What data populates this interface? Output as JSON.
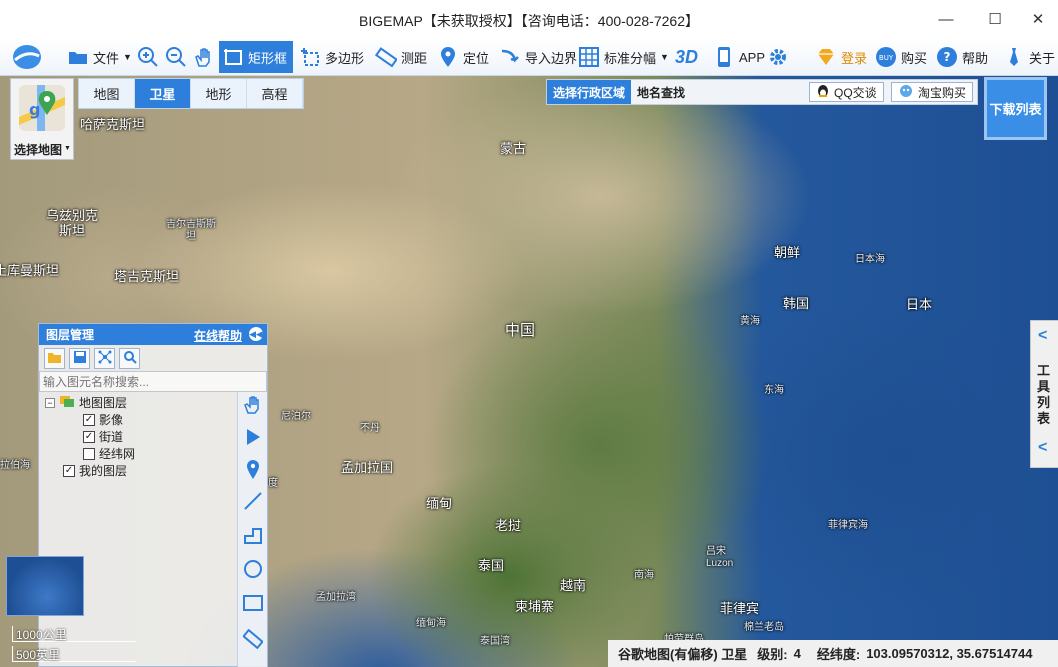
{
  "window": {
    "title": "BIGEMAP【未获取授权】【咨询电话：400-028-7262】",
    "minimize": "—",
    "maximize": "☐",
    "close": "✕"
  },
  "toolbar": {
    "file": "文件",
    "rect": "矩形框",
    "polygon": "多边形",
    "measure": "测距",
    "locate": "定位",
    "import_boundary": "导入边界",
    "standard_sheet": "标准分幅",
    "threed": "3D",
    "app": "APP",
    "login": "登录",
    "buy": "购买",
    "help": "帮助",
    "about": "关于",
    "colors": {
      "accent": "#2d7fdb",
      "login": "#e08a00"
    }
  },
  "select_map": {
    "label": "选择地图"
  },
  "map_tabs": [
    "地图",
    "卫星",
    "地形",
    "高程"
  ],
  "active_map_tab": "卫星",
  "admin": {
    "select_region": "选择行政区域",
    "place_search": "地名查找",
    "qq": "QQ交谈",
    "taobao": "淘宝购买"
  },
  "download_list": "下载列表",
  "tools_tab": "工具列表",
  "layer_panel": {
    "title": "图层管理",
    "help": "在线帮助",
    "search_placeholder": "输入图元名称搜索...",
    "tree": {
      "root": "地图图层",
      "imagery": "影像",
      "streets": "街道",
      "graticule": "经纬网",
      "my_layers": "我的图层"
    }
  },
  "map_labels": {
    "kazakhstan": "哈萨克斯坦",
    "mongolia": "蒙古",
    "uzbekistan": "乌兹别克斯坦",
    "kyrgyzstan": "吉尔吉斯斯坦",
    "turkmenistan": "土库曼斯坦",
    "tajikistan": "塔吉克斯坦",
    "north_korea": "朝鲜",
    "sea_of_japan": "日本海",
    "south_korea": "韩国",
    "japan": "日本",
    "yellow_sea": "黄海",
    "china": "中国",
    "east_china_sea": "东海",
    "nepal": "尼泊尔",
    "bhutan": "不丹",
    "bangladesh": "孟加拉国",
    "india": "印度",
    "myanmar": "缅甸",
    "laos": "老挝",
    "thailand": "泰国",
    "vietnam": "越南",
    "cambodia": "柬埔寨",
    "south_china_sea": "南海",
    "luzon": "吕宋\nLuzon",
    "philippine_sea": "菲律宾海",
    "philippines": "菲律宾",
    "bay_of_bengal": "孟加拉湾",
    "andaman": "缅甸海",
    "gulf_of_thailand": "泰国湾",
    "arabian": "拉伯海",
    "palau": "帕劳群岛",
    "mindanao": "棉兰老岛"
  },
  "scale": {
    "km": "1000公里",
    "mi": "500英里"
  },
  "status": {
    "source": "谷歌地图(有偏移) 卫星",
    "level_label": "级别:",
    "level_value": "4",
    "coord_label": "经纬度:",
    "coord_value": "103.09570312, 35.67514744"
  }
}
